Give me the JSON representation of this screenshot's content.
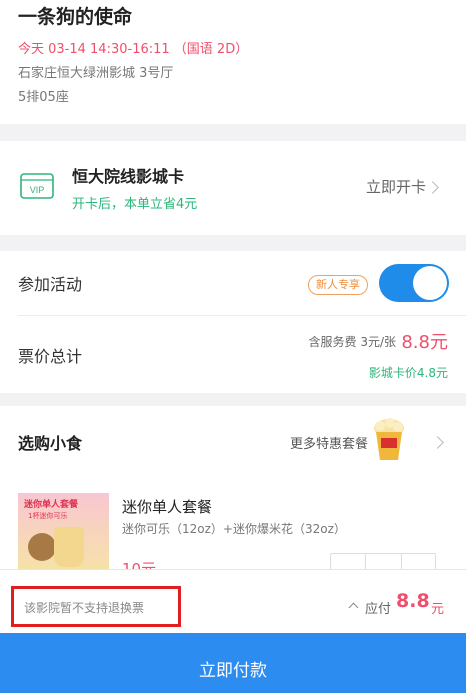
{
  "movie": {
    "title": "一条狗的使命",
    "show_time": "今天 03-14 14:30-16:11 （国语 2D）",
    "cinema": "石家庄恒大绿洲影城 3号厅",
    "seat": "5排05座"
  },
  "card_promo": {
    "icon_text": "VIP",
    "name": "恒大院线影城卡",
    "description": "开卡后，本单立省4元",
    "action_label": "立即开卡"
  },
  "activity": {
    "label": "参加活动",
    "badge": "新人专享",
    "toggle_on": true
  },
  "price": {
    "label": "票价总计",
    "service_fee": "含服务费 3元/张",
    "total": "8.8元",
    "card_price": "影城卡价4.8元"
  },
  "snacks": {
    "title": "选购小食",
    "more_label": "更多特惠套餐",
    "items": [
      {
        "image_text": "迷你单人套餐",
        "image_subtext": "1杯迷你可乐",
        "name": "迷你单人套餐",
        "description": "迷你可乐（12oz）+迷你爆米花（32oz）",
        "price": "10元"
      }
    ]
  },
  "bottom_bar": {
    "notice": "该影院暂不支持退换票",
    "pay_label": "应付",
    "pay_amount": "8.8",
    "pay_unit": "元"
  },
  "pay_button": {
    "label": "立即付款"
  },
  "colors": {
    "accent": "#2d8cf0",
    "price": "#ef4f6b",
    "green": "#2db67a",
    "badge": "#f08d3c"
  }
}
